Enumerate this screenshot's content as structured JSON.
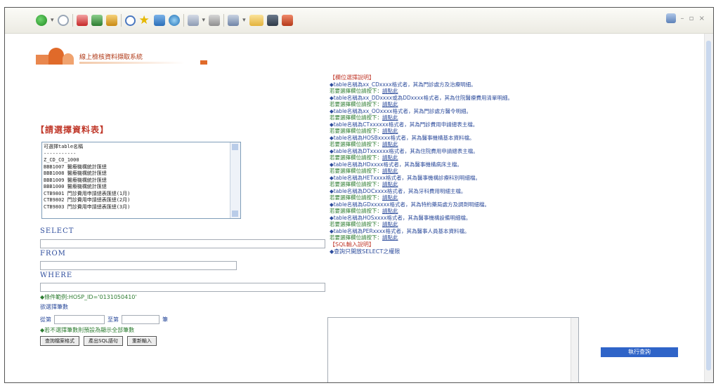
{
  "colors": {
    "heading_red": "#c0392b",
    "label_blue": "#2d4c9c",
    "note_green": "#2e7d32",
    "button_blue": "#2f64c8",
    "logo_orange": "#e06a2a"
  },
  "toolbar": {
    "icons": [
      "back-icon",
      "forward-icon",
      "stop-icon",
      "refresh-icon",
      "home-icon",
      "search-icon",
      "favorites-icon",
      "media-icon",
      "history-icon",
      "mail-icon",
      "print-icon",
      "edit-icon",
      "folder-icon",
      "grid-icon",
      "messenger-icon"
    ]
  },
  "logo": {
    "name": "線上檢核資料擷取系統"
  },
  "left": {
    "table_heading": "【請選擇資料表】",
    "table_list": [
      "可選擇table名稱",
      "-----------",
      "Z_CD_CO_1000",
      "BBB1007 醫療機構統計匯總",
      "BBB1008 醫療機構統計匯總",
      "BBB1009 醫療機構統計匯總",
      "BBB1000 醫療機構統計匯總",
      "CTB9801 門診費用申請總表匯總(1月)",
      "CTB9802 門診費用申請總表匯總(2月)",
      "CTB9803 門診費用申請總表匯總(3月)"
    ],
    "select_label": "SELECT",
    "from_label": "FROM",
    "where_label": "WHERE",
    "condition_example": "◆條件範例:HOSP_ID='0131050410'",
    "limit_label": "欲選擇筆數",
    "from_field_label": "從第",
    "to_field_label": "至第",
    "unit_label": "筆",
    "limit_note": "◆若不選擇筆數則預設為顯示全部筆數",
    "buttons": [
      "查詢檔案格式",
      "產出SQL語句",
      "重新輸入"
    ]
  },
  "right": {
    "heading": "【欄位選擇說明】",
    "lines": [
      {
        "text": "◆table名稱為xx_CDxxxx格式者，其為門診處方及治療明細。",
        "color": "blue"
      },
      {
        "text": "若要選擇欄位請按下：",
        "link": "請點此",
        "color": "green"
      },
      {
        "text": "◆table名稱為xx_DDxxxx或為DDxxxx格式者，其為住院醫療費用清單明細。",
        "color": "blue"
      },
      {
        "text": "若要選擇欄位請按下：",
        "link": "請點此",
        "color": "green"
      },
      {
        "text": "◆table名稱為xx_OOxxxx格式者，其為門診處方醫令明細。",
        "color": "blue"
      },
      {
        "text": "若要選擇欄位請按下：",
        "link": "請點此",
        "color": "green"
      },
      {
        "text": "◆table名稱為CTxxxxxx格式者，其為門診費用申請總表主檔。",
        "color": "blue"
      },
      {
        "text": "若要選擇欄位請按下：",
        "link": "請點此",
        "color": "green"
      },
      {
        "text": "◆table名稱為HOSBxxxx格式者，其為醫事機構基本資料檔。",
        "color": "blue"
      },
      {
        "text": "若要選擇欄位請按下：",
        "link": "請點此",
        "color": "green"
      },
      {
        "text": "◆table名稱為DTxxxxxx格式者，其為住院費用申請總表主檔。",
        "color": "blue"
      },
      {
        "text": "若要選擇欄位請按下：",
        "link": "請點此",
        "color": "green"
      },
      {
        "text": "◆table名稱為HDxxxx格式者，其為醫事機構病床主檔。",
        "color": "blue"
      },
      {
        "text": "若要選擇欄位請按下：",
        "link": "請點此",
        "color": "green"
      },
      {
        "text": "◆table名稱為HETxxxx格式者，其為醫事機構診療科別明細檔。",
        "color": "blue"
      },
      {
        "text": "若要選擇欄位請按下：",
        "link": "請點此",
        "color": "green"
      },
      {
        "text": "◆table名稱為DOCxxxx格式者，其為牙科費用明細主檔。",
        "color": "blue"
      },
      {
        "text": "若要選擇欄位請按下：",
        "link": "請點此",
        "color": "green"
      },
      {
        "text": "◆table名稱為GDxxxxxx格式者，其為特約藥局處方及調劑明細檔。",
        "color": "blue"
      },
      {
        "text": "若要選擇欄位請按下：",
        "link": "請點此",
        "color": "green"
      },
      {
        "text": "◆table名稱為HOSxxxx格式者，其為醫事機構設備明細檔。",
        "color": "blue"
      },
      {
        "text": "若要選擇欄位請按下：",
        "link": "請點此",
        "color": "green"
      },
      {
        "text": "◆table名稱為PERxxxx格式者，其為醫事人員基本資料檔。",
        "color": "blue"
      },
      {
        "text": "若要選擇欄位請按下：",
        "link": "請點此",
        "color": "green"
      }
    ],
    "sql_heading": "【SQL輸入說明】",
    "sql_note": "◆查詢只開放SELECT之權限"
  },
  "execute_button": "執行查詢"
}
